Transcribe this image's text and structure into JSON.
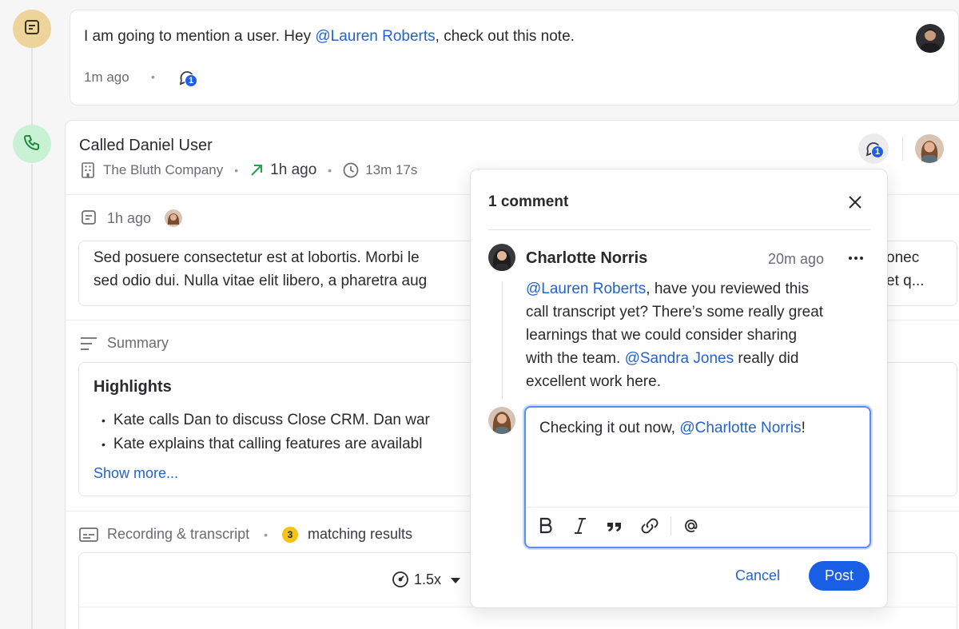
{
  "note": {
    "text_before": "I am going to mention a user. Hey ",
    "mention": "@Lauren Roberts",
    "text_after": ", check out this note.",
    "time": "1m ago",
    "comment_count": "1"
  },
  "call": {
    "title": "Called Daniel User",
    "company": "The Bluth Company",
    "time": "1h ago",
    "duration": "13m 17s",
    "comment_count": "1",
    "note_time": "1h ago",
    "note_text_line1": "Sed posuere consectetur est at lobortis. Morbi le",
    "note_text_line2": "sed odio dui. Nulla vitae elit libero, a pharetra aug",
    "note_text_right1": "onec",
    "note_text_right2": "et q...",
    "summary_label": "Summary",
    "highlights_title": "Highlights",
    "highlights": [
      "Kate calls Dan to discuss Close CRM. Dan war",
      "Kate explains that calling features are availabl"
    ],
    "show_more": "Show more...",
    "recording_label": "Recording & transcript",
    "matching_count": "3",
    "matching_label": "matching results",
    "playback_speed": "1.5x"
  },
  "popover": {
    "title": "1 comment",
    "comment": {
      "author": "Charlotte Norris",
      "time": "20m ago",
      "mention1": "@Lauren Roberts",
      "line1_rest": ", have you reviewed this",
      "line2": "call transcript yet? There’s some really great",
      "line3": "learnings that we could consider sharing",
      "line4_before": "with the team. ",
      "mention2": "@Sandra Jones",
      "line4_after": " really did",
      "line5": "excellent work here."
    },
    "reply": {
      "text_before": "Checking it out now, ",
      "mention": "@Charlotte Norris",
      "text_after": "!"
    },
    "cancel_label": "Cancel",
    "post_label": "Post"
  },
  "colors": {
    "accent": "#1a5ee6",
    "mention": "#2563c9",
    "note_badge": "#edd49b",
    "call_badge": "#c9f1d4"
  }
}
